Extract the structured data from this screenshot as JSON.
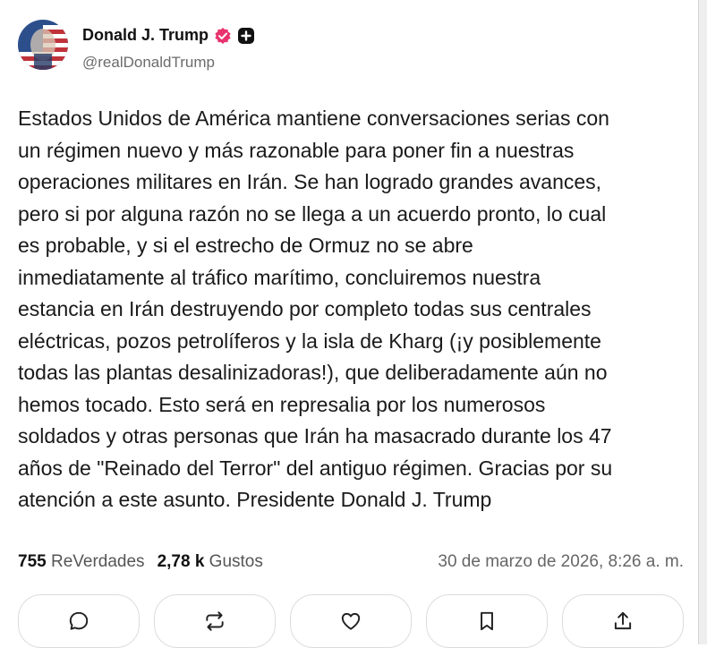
{
  "author": {
    "name": "Donald J. Trump",
    "handle": "@realDonaldTrump",
    "verified_color": "#e8336d"
  },
  "post": {
    "text": "Estados Unidos de América mantiene conversaciones serias con\nun régimen nuevo y más razonable para poner fin a nuestras\noperaciones militares en Irán. Se han logrado grandes avances,\npero si por alguna razón no se llega a un acuerdo pronto, lo cual\nes probable, y si el estrecho de Ormuz no se abre\ninmediatamente al tráfico marítimo, concluiremos nuestra\nestancia en Irán destruyendo por completo todas sus centrales\neléctricas, pozos petrolíferos y la isla de Kharg (¡y posiblemente\ntodas las plantas desalinizadoras!), que deliberadamente aún no\nhemos tocado. Esto será en represalia por los numerosos\nsoldados y otras personas que Irán ha masacrado durante los 47\naños de \"Reinado del Terror\" del antiguo régimen. Gracias por su\natención a este asunto. Presidente Donald J. Trump"
  },
  "stats": {
    "reposts_count": "755",
    "reposts_label": "ReVerdades",
    "likes_count": "2,78 k",
    "likes_label": "Gustos",
    "timestamp": "30 de marzo de 2026, 8:26 a. m."
  },
  "actions": [
    {
      "icon": "reply-icon"
    },
    {
      "icon": "repost-icon"
    },
    {
      "icon": "like-icon"
    },
    {
      "icon": "bookmark-icon"
    },
    {
      "icon": "share-icon"
    }
  ]
}
